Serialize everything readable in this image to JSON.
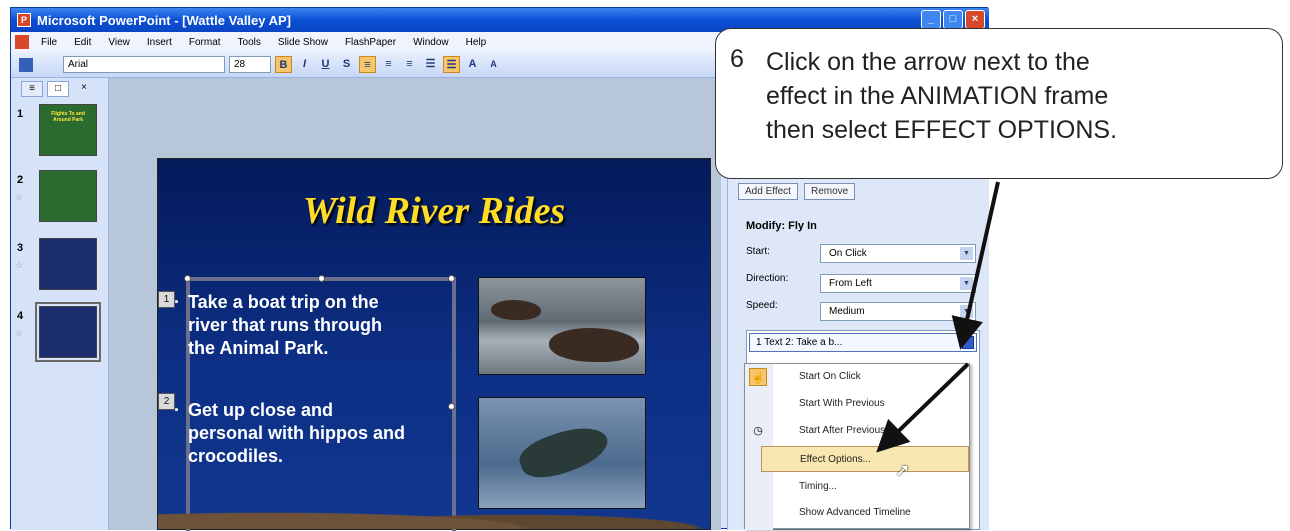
{
  "window": {
    "title": "Microsoft PowerPoint - [Wattle Valley AP]"
  },
  "menu": [
    "File",
    "Edit",
    "View",
    "Insert",
    "Format",
    "Tools",
    "Slide Show",
    "FlashPaper",
    "Window",
    "Help"
  ],
  "toolbar": {
    "font": "Arial",
    "size": "28",
    "bold": "B",
    "italic": "I",
    "underline": "U",
    "shadow": "S",
    "grow": "A",
    "shrink": "A"
  },
  "thumbnails": [
    {
      "num": "1",
      "text": "Flights To and Around Park"
    },
    {
      "num": "2",
      "text": ""
    },
    {
      "num": "3",
      "text": ""
    },
    {
      "num": "4",
      "text": ""
    }
  ],
  "slide": {
    "title": "Wild River Rides",
    "bullets": [
      {
        "tag": "1",
        "text": "Take a boat trip on the river that runs through the Animal Park."
      },
      {
        "tag": "2",
        "text": "Get up close and personal with hippos and crocodiles."
      }
    ]
  },
  "taskpane": {
    "add_effect": "Add Effect",
    "remove": "Remove",
    "modify": "Modify: Fly In",
    "start_label": "Start:",
    "start_value": "On Click",
    "direction_label": "Direction:",
    "direction_value": "From Left",
    "speed_label": "Speed:",
    "speed_value": "Medium",
    "list_item": "1   Text 2: Take a b..."
  },
  "context_menu": [
    "Start On Click",
    "Start With Previous",
    "Start After Previous",
    "Effect Options...",
    "Timing...",
    "Show Advanced Timeline"
  ],
  "callout": {
    "step": "6",
    "text": "Click on the arrow next to the effect in the ANIMATION frame then select EFFECT OPTIONS."
  },
  "colors": {
    "titlebar": "#0b4fd4",
    "slide_bg": "#0d2f85",
    "slide_title": "#ffdd27",
    "highlight": "#f8e7b0"
  }
}
